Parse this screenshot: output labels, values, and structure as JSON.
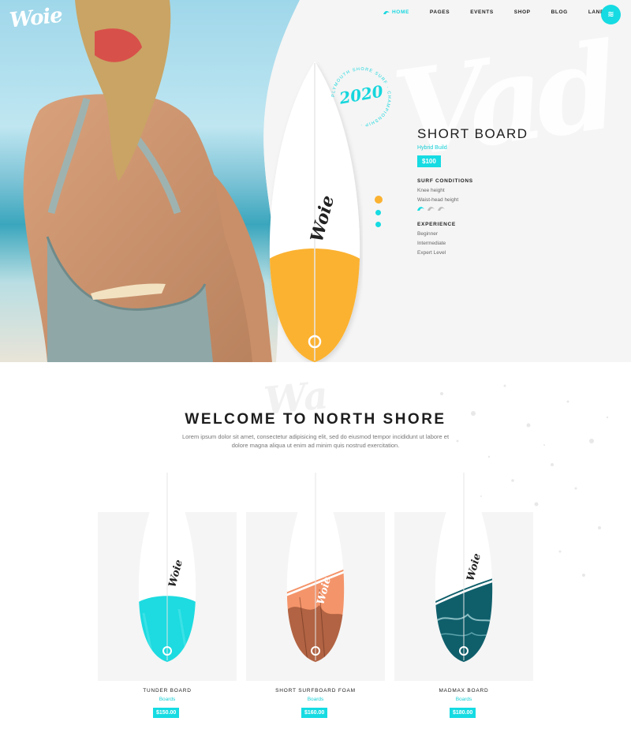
{
  "brand": {
    "logo_text": "Woie"
  },
  "nav": {
    "items": [
      {
        "label": "HOME",
        "active": true
      },
      {
        "label": "PAGES",
        "active": false
      },
      {
        "label": "EVENTS",
        "active": false
      },
      {
        "label": "SHOP",
        "active": false
      },
      {
        "label": "BLOG",
        "active": false
      },
      {
        "label": "LANDING",
        "active": false
      }
    ],
    "menu_icon": "waves-icon"
  },
  "hero": {
    "badge_year": "2020",
    "badge_ring_text": "PLYMOUTH SHORE SURF · CHAMPIONSHIP ·",
    "bg_script": "Vad",
    "product_name": "SHORT BOARD",
    "product_build": "Hybrid Build",
    "product_price": "$100",
    "conditions_title": "SURF CONDITIONS",
    "conditions": [
      "Knee height",
      "Waist-head height"
    ],
    "wave_rating": {
      "filled": 1,
      "total": 3
    },
    "experience_title": "EXPERIENCE",
    "experience": [
      "Beginner",
      "Intermediate",
      "Expert Level"
    ],
    "slider_dots": 3,
    "board_logo": "Woie"
  },
  "welcome": {
    "title": "WELCOME TO NORTH SHORE",
    "text": "Lorem ipsum dolor sit amet, consectetur adipisicing elit, sed do eiusmod tempor incididunt ut labore et dolore magna aliqua ut enim ad minim quis nostrud exercitation.",
    "bg_script": "Wa"
  },
  "products": [
    {
      "title": "TUNDER BOARD",
      "category": "Boards",
      "price": "$150.00"
    },
    {
      "title": "SHORT SURFBOARD FOAM",
      "category": "Boards",
      "price": "$160.00"
    },
    {
      "title": "MADMAX BOARD",
      "category": "Boards",
      "price": "$180.00"
    }
  ],
  "colors": {
    "accent": "#16dbe2",
    "orange": "#fbb231",
    "coral": "#f4946a",
    "ocean": "#0f5f6b"
  }
}
